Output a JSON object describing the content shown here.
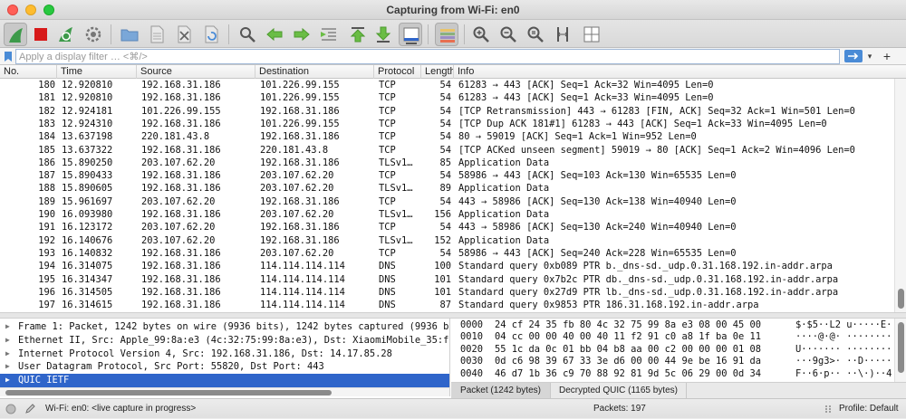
{
  "window": {
    "title": "Capturing from Wi-Fi: en0"
  },
  "colors": {
    "selection": "#2f65ca",
    "start_fin": "#3d9a4a",
    "stop": "#d71a1a",
    "accent": "#4a8bd6"
  },
  "toolbar": {
    "icons": [
      "start-capture-icon",
      "stop-capture-icon",
      "restart-capture-icon",
      "capture-options-icon",
      "open-file-icon",
      "save-file-icon",
      "close-file-icon",
      "reload-file-icon",
      "find-packet-icon",
      "go-back-icon",
      "go-forward-icon",
      "go-to-packet-icon",
      "go-first-icon",
      "go-last-icon",
      "auto-scroll-icon",
      "colorize-icon",
      "zoom-in-icon",
      "zoom-out-icon",
      "zoom-normal-icon",
      "resize-columns-icon",
      "layout-icon"
    ]
  },
  "filter": {
    "placeholder": "Apply a display filter … <⌘/>",
    "value": "",
    "add_label": "+",
    "dropdown_label": "▾"
  },
  "columns": [
    "No.",
    "Time",
    "Source",
    "Destination",
    "Protocol",
    "Length",
    "Info"
  ],
  "packets": [
    {
      "no": "180",
      "time": "12.920810",
      "src": "192.168.31.186",
      "dst": "101.226.99.155",
      "proto": "TCP",
      "len": "54",
      "info": "61283 → 443 [ACK] Seq=1 Ack=32 Win=4095 Len=0"
    },
    {
      "no": "181",
      "time": "12.920810",
      "src": "192.168.31.186",
      "dst": "101.226.99.155",
      "proto": "TCP",
      "len": "54",
      "info": "61283 → 443 [ACK] Seq=1 Ack=33 Win=4095 Len=0"
    },
    {
      "no": "182",
      "time": "12.924181",
      "src": "101.226.99.155",
      "dst": "192.168.31.186",
      "proto": "TCP",
      "len": "54",
      "info": "[TCP Retransmission] 443 → 61283 [FIN, ACK] Seq=32 Ack=1 Win=501 Len=0"
    },
    {
      "no": "183",
      "time": "12.924310",
      "src": "192.168.31.186",
      "dst": "101.226.99.155",
      "proto": "TCP",
      "len": "54",
      "info": "[TCP Dup ACK 181#1] 61283 → 443 [ACK] Seq=1 Ack=33 Win=4095 Len=0"
    },
    {
      "no": "184",
      "time": "13.637198",
      "src": "220.181.43.8",
      "dst": "192.168.31.186",
      "proto": "TCP",
      "len": "54",
      "info": "80 → 59019 [ACK] Seq=1 Ack=1 Win=952 Len=0"
    },
    {
      "no": "185",
      "time": "13.637322",
      "src": "192.168.31.186",
      "dst": "220.181.43.8",
      "proto": "TCP",
      "len": "54",
      "info": "[TCP ACKed unseen segment] 59019 → 80 [ACK] Seq=1 Ack=2 Win=4096 Len=0"
    },
    {
      "no": "186",
      "time": "15.890250",
      "src": "203.107.62.20",
      "dst": "192.168.31.186",
      "proto": "TLSv1…",
      "len": "85",
      "info": "Application Data"
    },
    {
      "no": "187",
      "time": "15.890433",
      "src": "192.168.31.186",
      "dst": "203.107.62.20",
      "proto": "TCP",
      "len": "54",
      "info": "58986 → 443 [ACK] Seq=103 Ack=130 Win=65535 Len=0"
    },
    {
      "no": "188",
      "time": "15.890605",
      "src": "192.168.31.186",
      "dst": "203.107.62.20",
      "proto": "TLSv1…",
      "len": "89",
      "info": "Application Data"
    },
    {
      "no": "189",
      "time": "15.961697",
      "src": "203.107.62.20",
      "dst": "192.168.31.186",
      "proto": "TCP",
      "len": "54",
      "info": "443 → 58986 [ACK] Seq=130 Ack=138 Win=40940 Len=0"
    },
    {
      "no": "190",
      "time": "16.093980",
      "src": "192.168.31.186",
      "dst": "203.107.62.20",
      "proto": "TLSv1…",
      "len": "156",
      "info": "Application Data"
    },
    {
      "no": "191",
      "time": "16.123172",
      "src": "203.107.62.20",
      "dst": "192.168.31.186",
      "proto": "TCP",
      "len": "54",
      "info": "443 → 58986 [ACK] Seq=130 Ack=240 Win=40940 Len=0"
    },
    {
      "no": "192",
      "time": "16.140676",
      "src": "203.107.62.20",
      "dst": "192.168.31.186",
      "proto": "TLSv1…",
      "len": "152",
      "info": "Application Data"
    },
    {
      "no": "193",
      "time": "16.140832",
      "src": "192.168.31.186",
      "dst": "203.107.62.20",
      "proto": "TCP",
      "len": "54",
      "info": "58986 → 443 [ACK] Seq=240 Ack=228 Win=65535 Len=0"
    },
    {
      "no": "194",
      "time": "16.314075",
      "src": "192.168.31.186",
      "dst": "114.114.114.114",
      "proto": "DNS",
      "len": "100",
      "info": "Standard query 0xb089 PTR b._dns-sd._udp.0.31.168.192.in-addr.arpa"
    },
    {
      "no": "195",
      "time": "16.314347",
      "src": "192.168.31.186",
      "dst": "114.114.114.114",
      "proto": "DNS",
      "len": "101",
      "info": "Standard query 0x7b2c PTR db._dns-sd._udp.0.31.168.192.in-addr.arpa"
    },
    {
      "no": "196",
      "time": "16.314505",
      "src": "192.168.31.186",
      "dst": "114.114.114.114",
      "proto": "DNS",
      "len": "101",
      "info": "Standard query 0x27d9 PTR lb._dns-sd._udp.0.31.168.192.in-addr.arpa"
    },
    {
      "no": "197",
      "time": "16.314615",
      "src": "192.168.31.186",
      "dst": "114.114.114.114",
      "proto": "DNS",
      "len": "87",
      "info": "Standard query 0x9853 PTR 186.31.168.192.in-addr.arpa"
    }
  ],
  "details": [
    {
      "text": "Frame 1: Packet, 1242 bytes on wire (9936 bits), 1242 bytes captured (9936 b",
      "selected": false
    },
    {
      "text": "Ethernet II, Src: Apple_99:8a:e3 (4c:32:75:99:8a:e3), Dst: XiaomiMobile_35:f",
      "selected": false
    },
    {
      "text": "Internet Protocol Version 4, Src: 192.168.31.186, Dst: 14.17.85.28",
      "selected": false
    },
    {
      "text": "User Datagram Protocol, Src Port: 55820, Dst Port: 443",
      "selected": false
    },
    {
      "text": "QUIC IETF",
      "selected": true
    }
  ],
  "hex": [
    {
      "offset": "0000",
      "bytes": "24 cf 24 35 fb 80 4c 32  75 99 8a e3 08 00 45 00",
      "ascii": "$·$5··L2 u·····E·"
    },
    {
      "offset": "0010",
      "bytes": "04 cc 00 00 40 00 40 11  f2 91 c0 a8 1f ba 0e 11",
      "ascii": "····@·@· ········"
    },
    {
      "offset": "0020",
      "bytes": "55 1c da 0c 01 bb 04 b8  aa 00 c2 00 00 00 01 08",
      "ascii": "U······· ········"
    },
    {
      "offset": "0030",
      "bytes": "0d c6 98 39 67 33 3e d6  00 00 44 9e be 16 91 da",
      "ascii": "···9g3>· ··D·····"
    },
    {
      "offset": "0040",
      "bytes": "46 d7 1b 36 c9 70 88 92  81 9d 5c 06 29 00 0d 34",
      "ascii": "F··6·p·· ··\\·)··4"
    }
  ],
  "byte_tabs": [
    "Packet (1242 bytes)",
    "Decrypted QUIC (1165 bytes)"
  ],
  "status": {
    "interface": "Wi-Fi: en0: <live capture in progress>",
    "packets": "Packets: 197",
    "profile": "Profile: Default"
  }
}
